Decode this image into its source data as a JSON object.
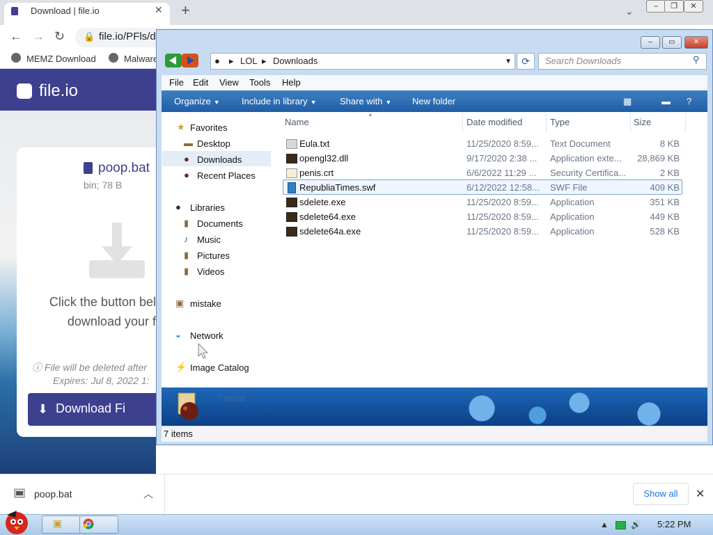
{
  "browser": {
    "tab_title": "Download | file.io",
    "url": "file.io/PFls/d",
    "bookmarks": [
      "MEMZ Download",
      "Malware"
    ]
  },
  "fileio": {
    "logo": "file.io",
    "file_name": "poop.bat",
    "file_meta": "bin; 78 B",
    "msg_line1": "Click the button bel",
    "msg_line2": "download your f",
    "warn": "File will be deleted after",
    "expires": "Expires: Jul 8, 2022 1:",
    "download_label": "Download Fi"
  },
  "explorer": {
    "breadcrumb": [
      "LOL",
      "Downloads"
    ],
    "search_placeholder": "Search Downloads",
    "menus": [
      "File",
      "Edit",
      "View",
      "Tools",
      "Help"
    ],
    "commands": [
      "Organize",
      "Include in library",
      "Share with",
      "New folder"
    ],
    "nav": {
      "favorites": "Favorites",
      "desktop": "Desktop",
      "downloads": "Downloads",
      "recent": "Recent Places",
      "libraries": "Libraries",
      "documents": "Documents",
      "music": "Music",
      "pictures": "Pictures",
      "videos": "Videos",
      "mistake": "mistake",
      "network": "Network",
      "image_catalog": "Image Catalog"
    },
    "columns": [
      "Name",
      "Date modified",
      "Type",
      "Size"
    ],
    "files": [
      {
        "name": "Eula.txt",
        "date": "11/25/2020 8:59...",
        "type": "Text Document",
        "size": "8 KB"
      },
      {
        "name": "opengl32.dll",
        "date": "9/17/2020 2:38 ...",
        "type": "Application exte...",
        "size": "28,869 KB"
      },
      {
        "name": "penis.crt",
        "date": "6/6/2022 11:29 ...",
        "type": "Security Certifica...",
        "size": "2 KB"
      },
      {
        "name": "RepubliaTimes.swf",
        "date": "6/12/2022 12:58...",
        "type": "SWF File",
        "size": "409 KB"
      },
      {
        "name": "sdelete.exe",
        "date": "11/25/2020 8:59...",
        "type": "Application",
        "size": "351 KB"
      },
      {
        "name": "sdelete64.exe",
        "date": "11/25/2020 8:59...",
        "type": "Application",
        "size": "449 KB"
      },
      {
        "name": "sdelete64a.exe",
        "date": "11/25/2020 8:59...",
        "type": "Application",
        "size": "528 KB"
      }
    ],
    "details_count": "7 items",
    "status_count": "7 items"
  },
  "shelf": {
    "file": "poop.bat",
    "show_all": "Show all"
  },
  "taskbar": {
    "clock": "5:22 PM"
  }
}
